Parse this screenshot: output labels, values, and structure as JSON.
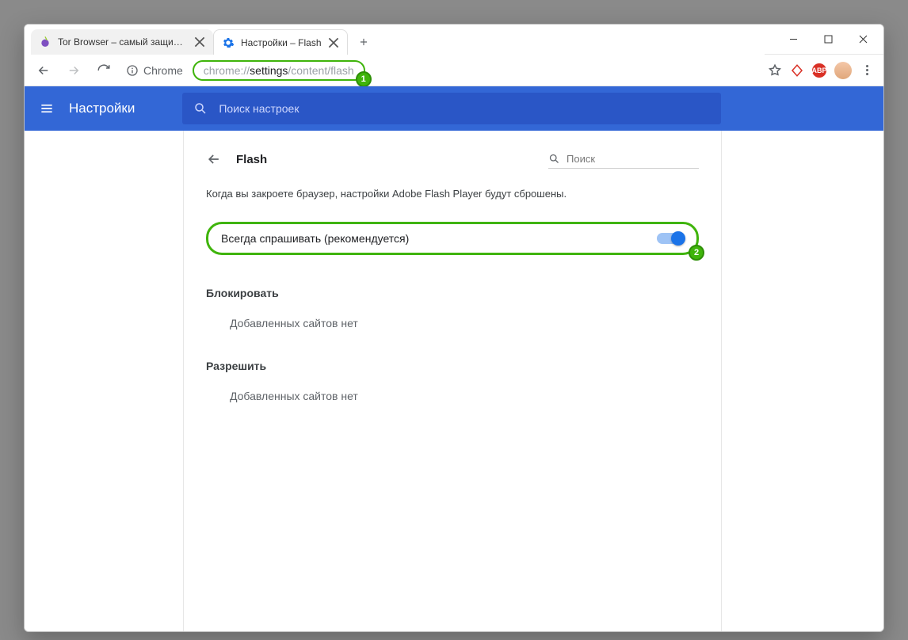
{
  "window_controls": {
    "minimize": "minimize",
    "maximize": "maximize",
    "close": "close"
  },
  "tabs": [
    {
      "title": "Tor Browser – самый защищенн",
      "active": false,
      "icon": "onion-favicon"
    },
    {
      "title": "Настройки – Flash",
      "active": true,
      "icon": "gear-favicon"
    }
  ],
  "omnibox": {
    "chip_label": "Chrome",
    "url_muted_prefix": "chrome://",
    "url_highlight": "settings",
    "url_muted_suffix": "/content/flash"
  },
  "annotations": {
    "badge1": "1",
    "badge2": "2"
  },
  "toolbar_right": {
    "star": "star-icon",
    "yandex": "yandex-icon",
    "abp": "ABP",
    "menu": "kebab-icon"
  },
  "settings_header": {
    "title": "Настройки",
    "search_placeholder": "Поиск настроек"
  },
  "page": {
    "heading": "Flash",
    "inline_search_placeholder": "Поиск",
    "info": "Когда вы закроете браузер, настройки Adobe Flash Player будут сброшены.",
    "toggle_label": "Всегда спрашивать (рекомендуется)",
    "toggle_on": true,
    "block_section": "Блокировать",
    "block_empty": "Добавленных сайтов нет",
    "allow_section": "Разрешить",
    "allow_empty": "Добавленных сайтов нет"
  }
}
